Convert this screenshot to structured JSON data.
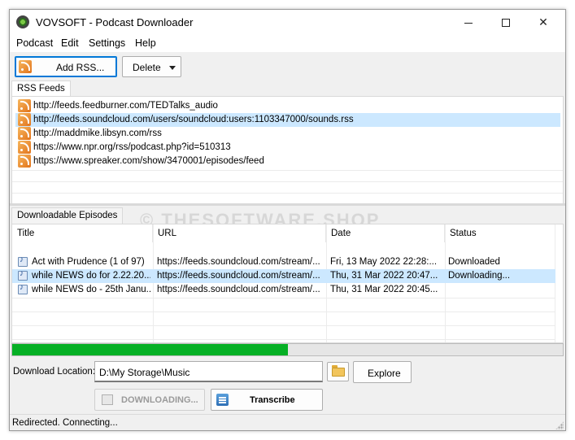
{
  "window": {
    "title": "VOVSOFT - Podcast Downloader",
    "controls": {
      "minimize": "",
      "maximize": "",
      "close": "✕"
    }
  },
  "menu": {
    "items": [
      "Podcast",
      "Edit",
      "Settings",
      "Help"
    ]
  },
  "toolbar": {
    "add_rss_label": "Add RSS...",
    "delete_label": "Delete"
  },
  "feeds": {
    "tab_label": "RSS Feeds",
    "items": [
      {
        "url": "http://feeds.feedburner.com/TEDTalks_audio",
        "selected": false
      },
      {
        "url": "http://feeds.soundcloud.com/users/soundcloud:users:1103347000/sounds.rss",
        "selected": true
      },
      {
        "url": "http://maddmike.libsyn.com/rss",
        "selected": false
      },
      {
        "url": "https://www.npr.org/rss/podcast.php?id=510313",
        "selected": false
      },
      {
        "url": "https://www.spreaker.com/show/3470001/episodes/feed",
        "selected": false
      }
    ]
  },
  "episodes": {
    "tab_label": "Downloadable Episodes",
    "columns": [
      "Title",
      "URL",
      "Date",
      "Status"
    ],
    "rows": [
      {
        "title": "Act with Prudence (1 of 97)",
        "url": "https://feeds.soundcloud.com/stream/...",
        "date": "Fri, 13 May 2022 22:28:...",
        "status": "Downloaded",
        "selected": false
      },
      {
        "title": "while NEWS do for 2.22.20...",
        "url": "https://feeds.soundcloud.com/stream/...",
        "date": "Thu, 31 Mar 2022 20:47...",
        "status": "Downloading...",
        "selected": true
      },
      {
        "title": "while NEWS do - 25th Janu...",
        "url": "https://feeds.soundcloud.com/stream/...",
        "date": "Thu, 31 Mar 2022 20:45...",
        "status": "",
        "selected": false
      }
    ]
  },
  "watermark": "© THESOFTWARE.SHOP",
  "progress": {
    "fraction": 0.5
  },
  "download": {
    "location_label": "Download Location:",
    "location_value": "D:\\My Storage\\Music",
    "explore_label": "Explore",
    "downloading_label": "DOWNLOADING...",
    "transcribe_label": "Transcribe"
  },
  "status": {
    "text": "Redirected. Connecting..."
  },
  "colors": {
    "selection": "#cce8ff",
    "progress": "#06b025",
    "accent_border": "#0078d7",
    "rss": "#e2731a"
  }
}
